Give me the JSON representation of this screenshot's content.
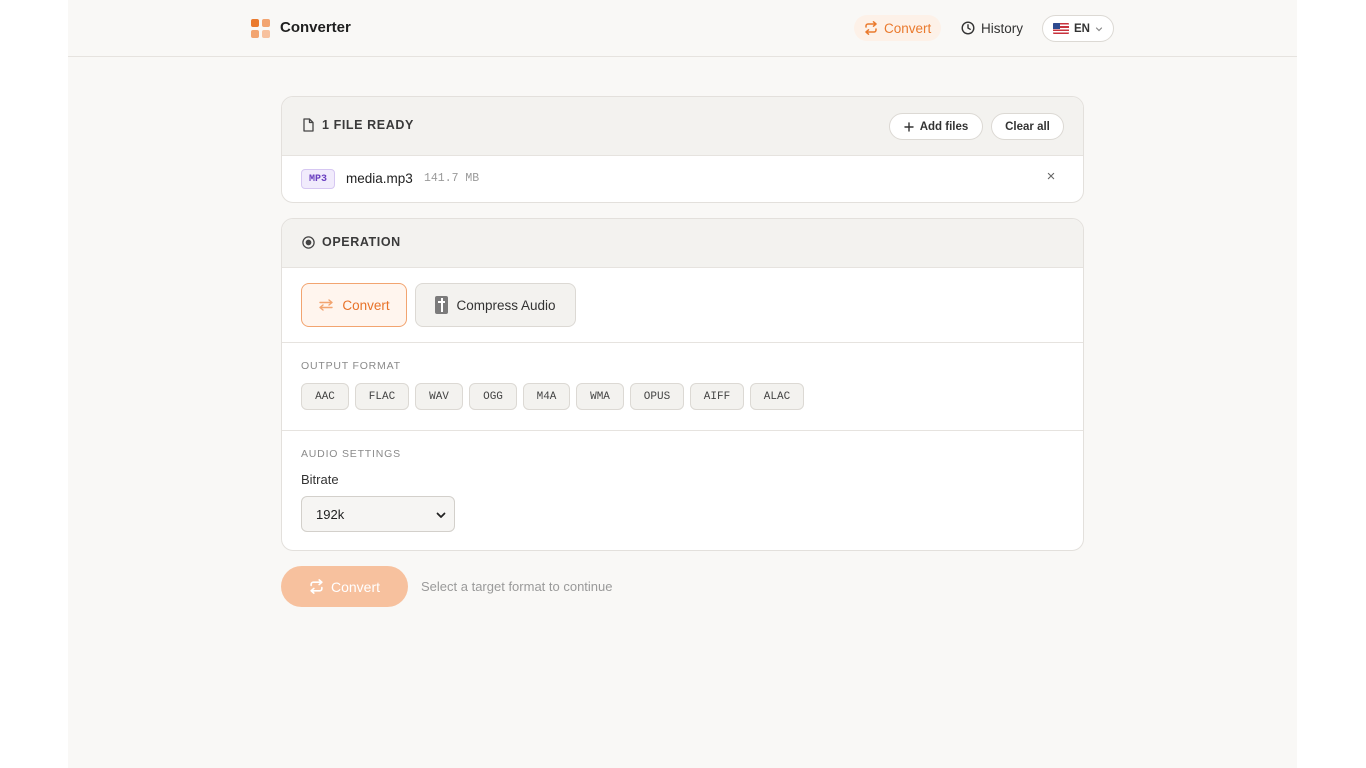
{
  "app": {
    "brand": "Converter"
  },
  "nav": {
    "convert_label": "Convert",
    "history_label": "History",
    "lang_label": "EN"
  },
  "files": {
    "header": "1 FILE READY",
    "add_files_label": "Add files",
    "clear_all_label": "Clear all",
    "items": [
      {
        "type": "MP3",
        "name": "media.mp3",
        "size": "141.7 MB"
      }
    ]
  },
  "operation": {
    "header": "OPERATION",
    "options": [
      {
        "label": "Convert",
        "selected": true
      },
      {
        "label": "Compress Audio",
        "selected": false
      }
    ]
  },
  "output_format": {
    "label": "OUTPUT FORMAT",
    "formats": [
      "AAC",
      "FLAC",
      "WAV",
      "OGG",
      "M4A",
      "WMA",
      "OPUS",
      "AIFF",
      "ALAC"
    ]
  },
  "audio_settings": {
    "label": "AUDIO SETTINGS",
    "bitrate_label": "Bitrate",
    "bitrate_value": "192k"
  },
  "action": {
    "convert_label": "Convert",
    "hint": "Select a target format to continue"
  },
  "colors": {
    "accent": "#ea7a2e",
    "accent_soft": "#f7c19e",
    "badge_purple": "#6a3fc0",
    "background": "#f9f8f6"
  }
}
